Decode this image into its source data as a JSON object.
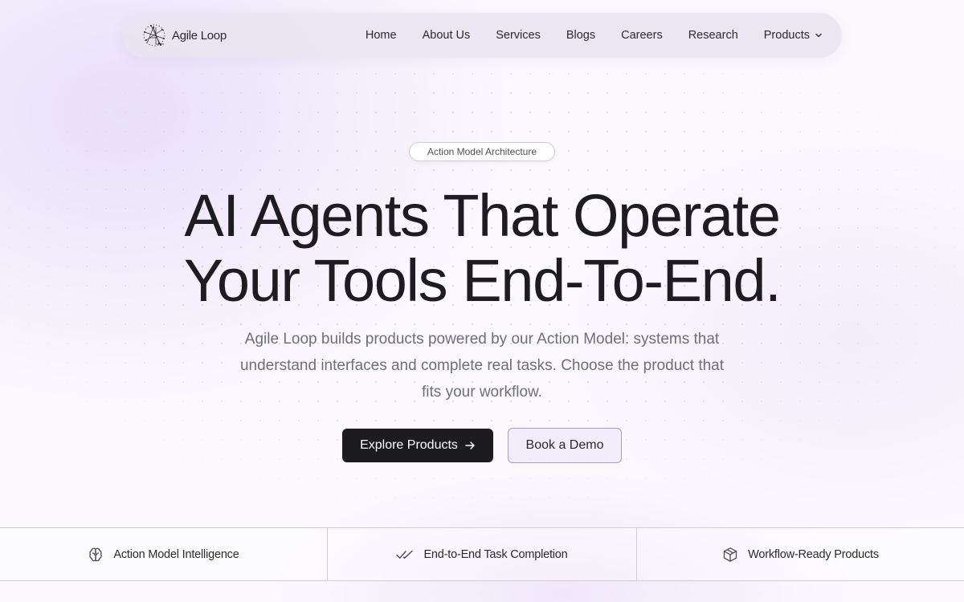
{
  "nav": {
    "logo_text": "Agile Loop",
    "links": [
      "Home",
      "About Us",
      "Services",
      "Blogs",
      "Careers",
      "Research",
      "Products"
    ]
  },
  "hero": {
    "badge": "Action Model Architecture",
    "headline_line1": "AI Agents That Operate",
    "headline_line2": "Your Tools End-To-End.",
    "subtitle_line1": "Agile Loop builds products powered by our Action Model: systems that",
    "subtitle_line2": "understand interfaces and complete real tasks. Choose the product that",
    "subtitle_line3": "fits your workflow.",
    "primary_button": "Explore Products",
    "secondary_button": "Book a Demo"
  },
  "features": [
    {
      "label": "Action Model Intelligence",
      "icon": "brain-icon"
    },
    {
      "label": "End-to-End Task Completion",
      "icon": "double-check-icon"
    },
    {
      "label": "Workflow-Ready Products",
      "icon": "box-icon"
    }
  ],
  "colors": {
    "primary_button_bg": "#1c1c1f",
    "secondary_button_border": "#a79bcf",
    "headline": "#1d1d21",
    "subtitle": "#6f6f77"
  }
}
